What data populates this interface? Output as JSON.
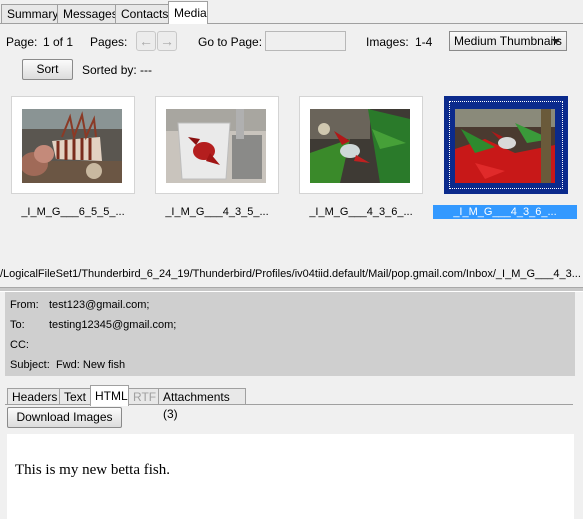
{
  "tabs": [
    {
      "label": "Summary"
    },
    {
      "label": "Messages"
    },
    {
      "label": "Contacts"
    },
    {
      "label": "Media"
    }
  ],
  "toolbar": {
    "page_label": "Page:",
    "page_value": "1 of 1",
    "pages_label": "Pages:",
    "goto_label": "Go to Page:",
    "goto_value": "",
    "images_label": "Images:",
    "images_value": "1-4",
    "thumb_size": "Medium Thumbnails",
    "sort_button": "Sort",
    "sorted_by": "Sorted by: ---"
  },
  "thumbnails": [
    {
      "label": "_I_M_G___6_5_5_...",
      "subject": "lionfish"
    },
    {
      "label": "_I_M_G___4_3_5_...",
      "subject": "betta in cup"
    },
    {
      "label": "_I_M_G___4_3_6_...",
      "subject": "betta in plants"
    },
    {
      "label": "_I_M_G___4_3_6_...",
      "subject": "betta with red plants",
      "selected": true
    }
  ],
  "path": "/LogicalFileSet1/Thunderbird_6_24_19/Thunderbird/Profiles/iv04tiid.default/Mail/pop.gmail.com/Inbox/_I_M_G___4_3...",
  "headers": {
    "from_label": "From:",
    "from_value": "test123@gmail.com;",
    "to_label": "To:",
    "to_value": "testing12345@gmail.com;",
    "cc_label": "CC:",
    "cc_value": "",
    "subject_label": "Subject:",
    "subject_value": "Fwd: New fish"
  },
  "view_tabs": [
    {
      "label": "Headers"
    },
    {
      "label": "Text"
    },
    {
      "label": "HTML"
    },
    {
      "label": "RTF"
    },
    {
      "label": "Attachments (3)"
    }
  ],
  "download_button": "Download Images",
  "body_text": "This is my new betta fish.",
  "colors": {
    "selection_frame": "#0b2a8c",
    "selection_label": "#3399ff",
    "header_panel": "#cfcfcf"
  }
}
